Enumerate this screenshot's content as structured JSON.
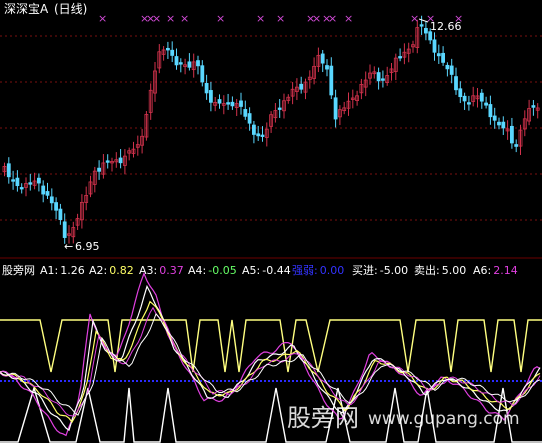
{
  "app": {
    "stock_title": "深深宝A",
    "period": "(日线)"
  },
  "price_chart": {
    "high_marker": "12.66",
    "low_marker": "6.95",
    "up_color": "#d2324c",
    "down_color": "#5ad7ff",
    "signal_mark": "×",
    "signal_color": "#d14bd6"
  },
  "indicator": {
    "name": "股旁网",
    "items": [
      {
        "label": "A1:",
        "value": "1.26",
        "color": "#ffffff"
      },
      {
        "label": "A2:",
        "value": "0.82",
        "color": "#ffff66"
      },
      {
        "label": "A3:",
        "value": "0.37",
        "color": "#e040e0"
      },
      {
        "label": "A4:",
        "value": "-0.05",
        "color": "#66ff66"
      },
      {
        "label": "A5:",
        "value": "-0.44",
        "color": "#ffffff"
      },
      {
        "label": "强弱:",
        "value": "0.00",
        "color": "#3333ff"
      },
      {
        "label": "买进:",
        "value": "-5.00",
        "color": "#ffffff"
      },
      {
        "label": "卖出:",
        "value": "5.00",
        "color": "#ffffff"
      },
      {
        "label": "A6:",
        "value": "2.14",
        "color": "#e040e0"
      }
    ]
  },
  "watermark": {
    "cn": "股旁网",
    "url": "www.gupang.com"
  }
}
